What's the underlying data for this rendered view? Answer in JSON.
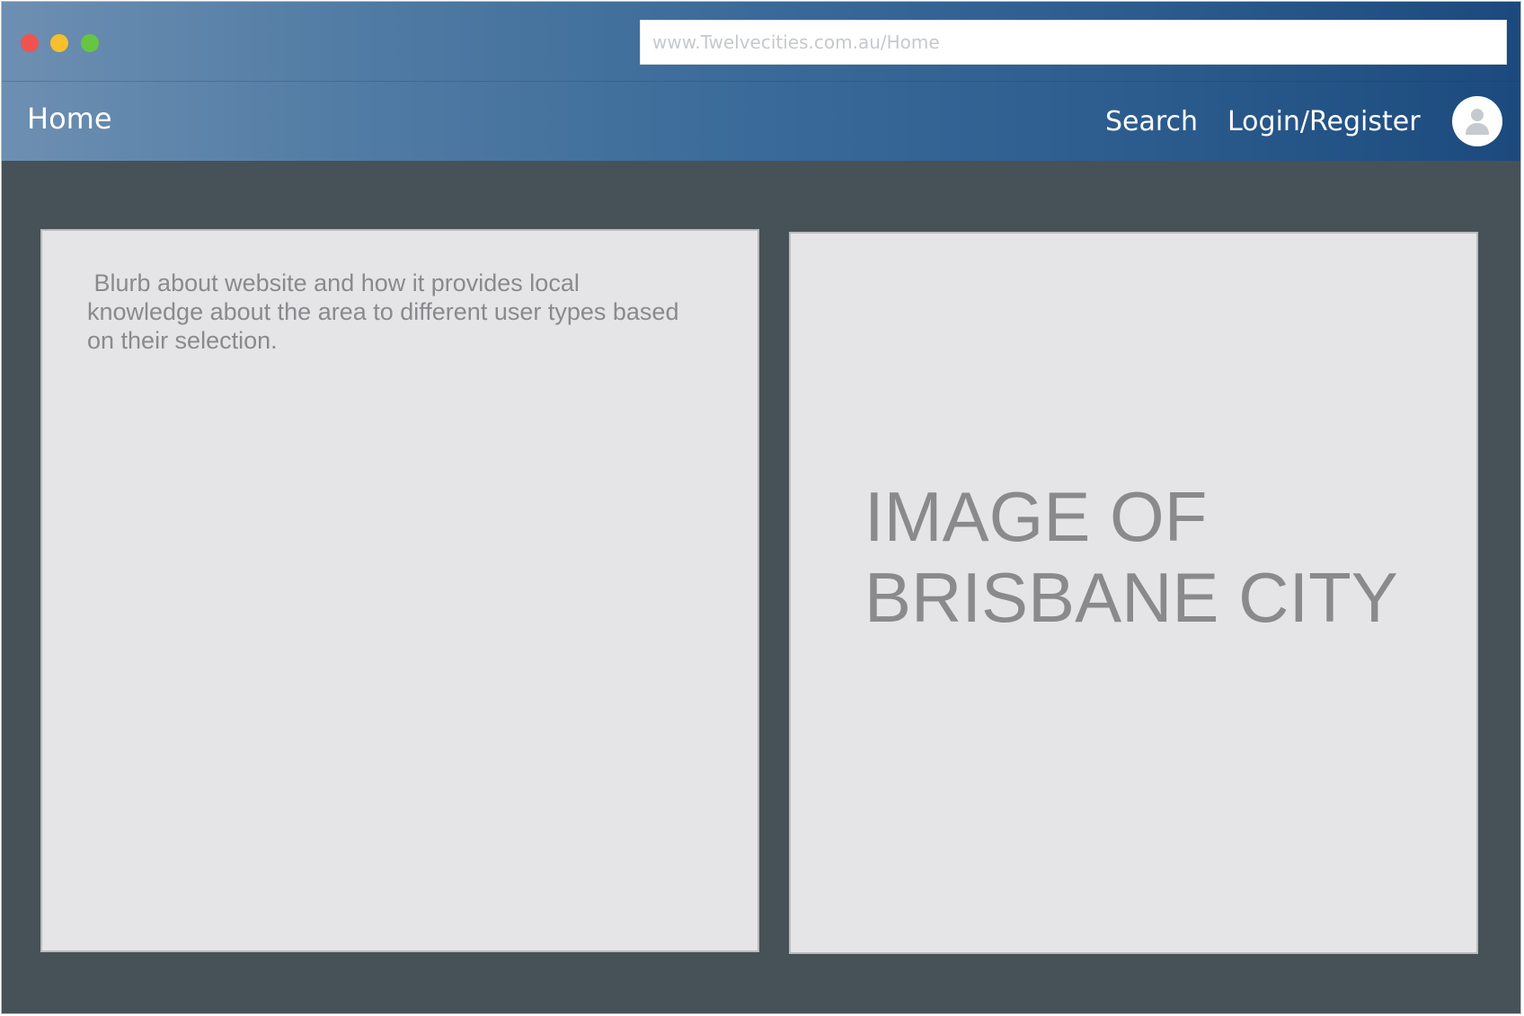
{
  "browser": {
    "url": "www.Twelvecities.com.au/Home",
    "colors": {
      "close": "#f0534f",
      "minimize": "#f7bf2d",
      "maximize": "#66c541"
    }
  },
  "nav": {
    "home_label": "Home",
    "links": [
      {
        "label": "Search"
      },
      {
        "label": "Login/Register"
      }
    ],
    "avatar_icon": "user-avatar-icon"
  },
  "main": {
    "blurb": " Blurb about website and how it provides local\nknowledge about the area to different user types based\non their selection.",
    "image_placeholder_line1": "IMAGE OF",
    "image_placeholder_line2": "BRISBANE CITY"
  },
  "theme": {
    "header_gradient_start": "#6d8fb2",
    "header_gradient_end": "#1c4a7e",
    "page_background": "#465257",
    "panel_background": "#e5e5e8",
    "muted_text": "#8a8a8c"
  }
}
